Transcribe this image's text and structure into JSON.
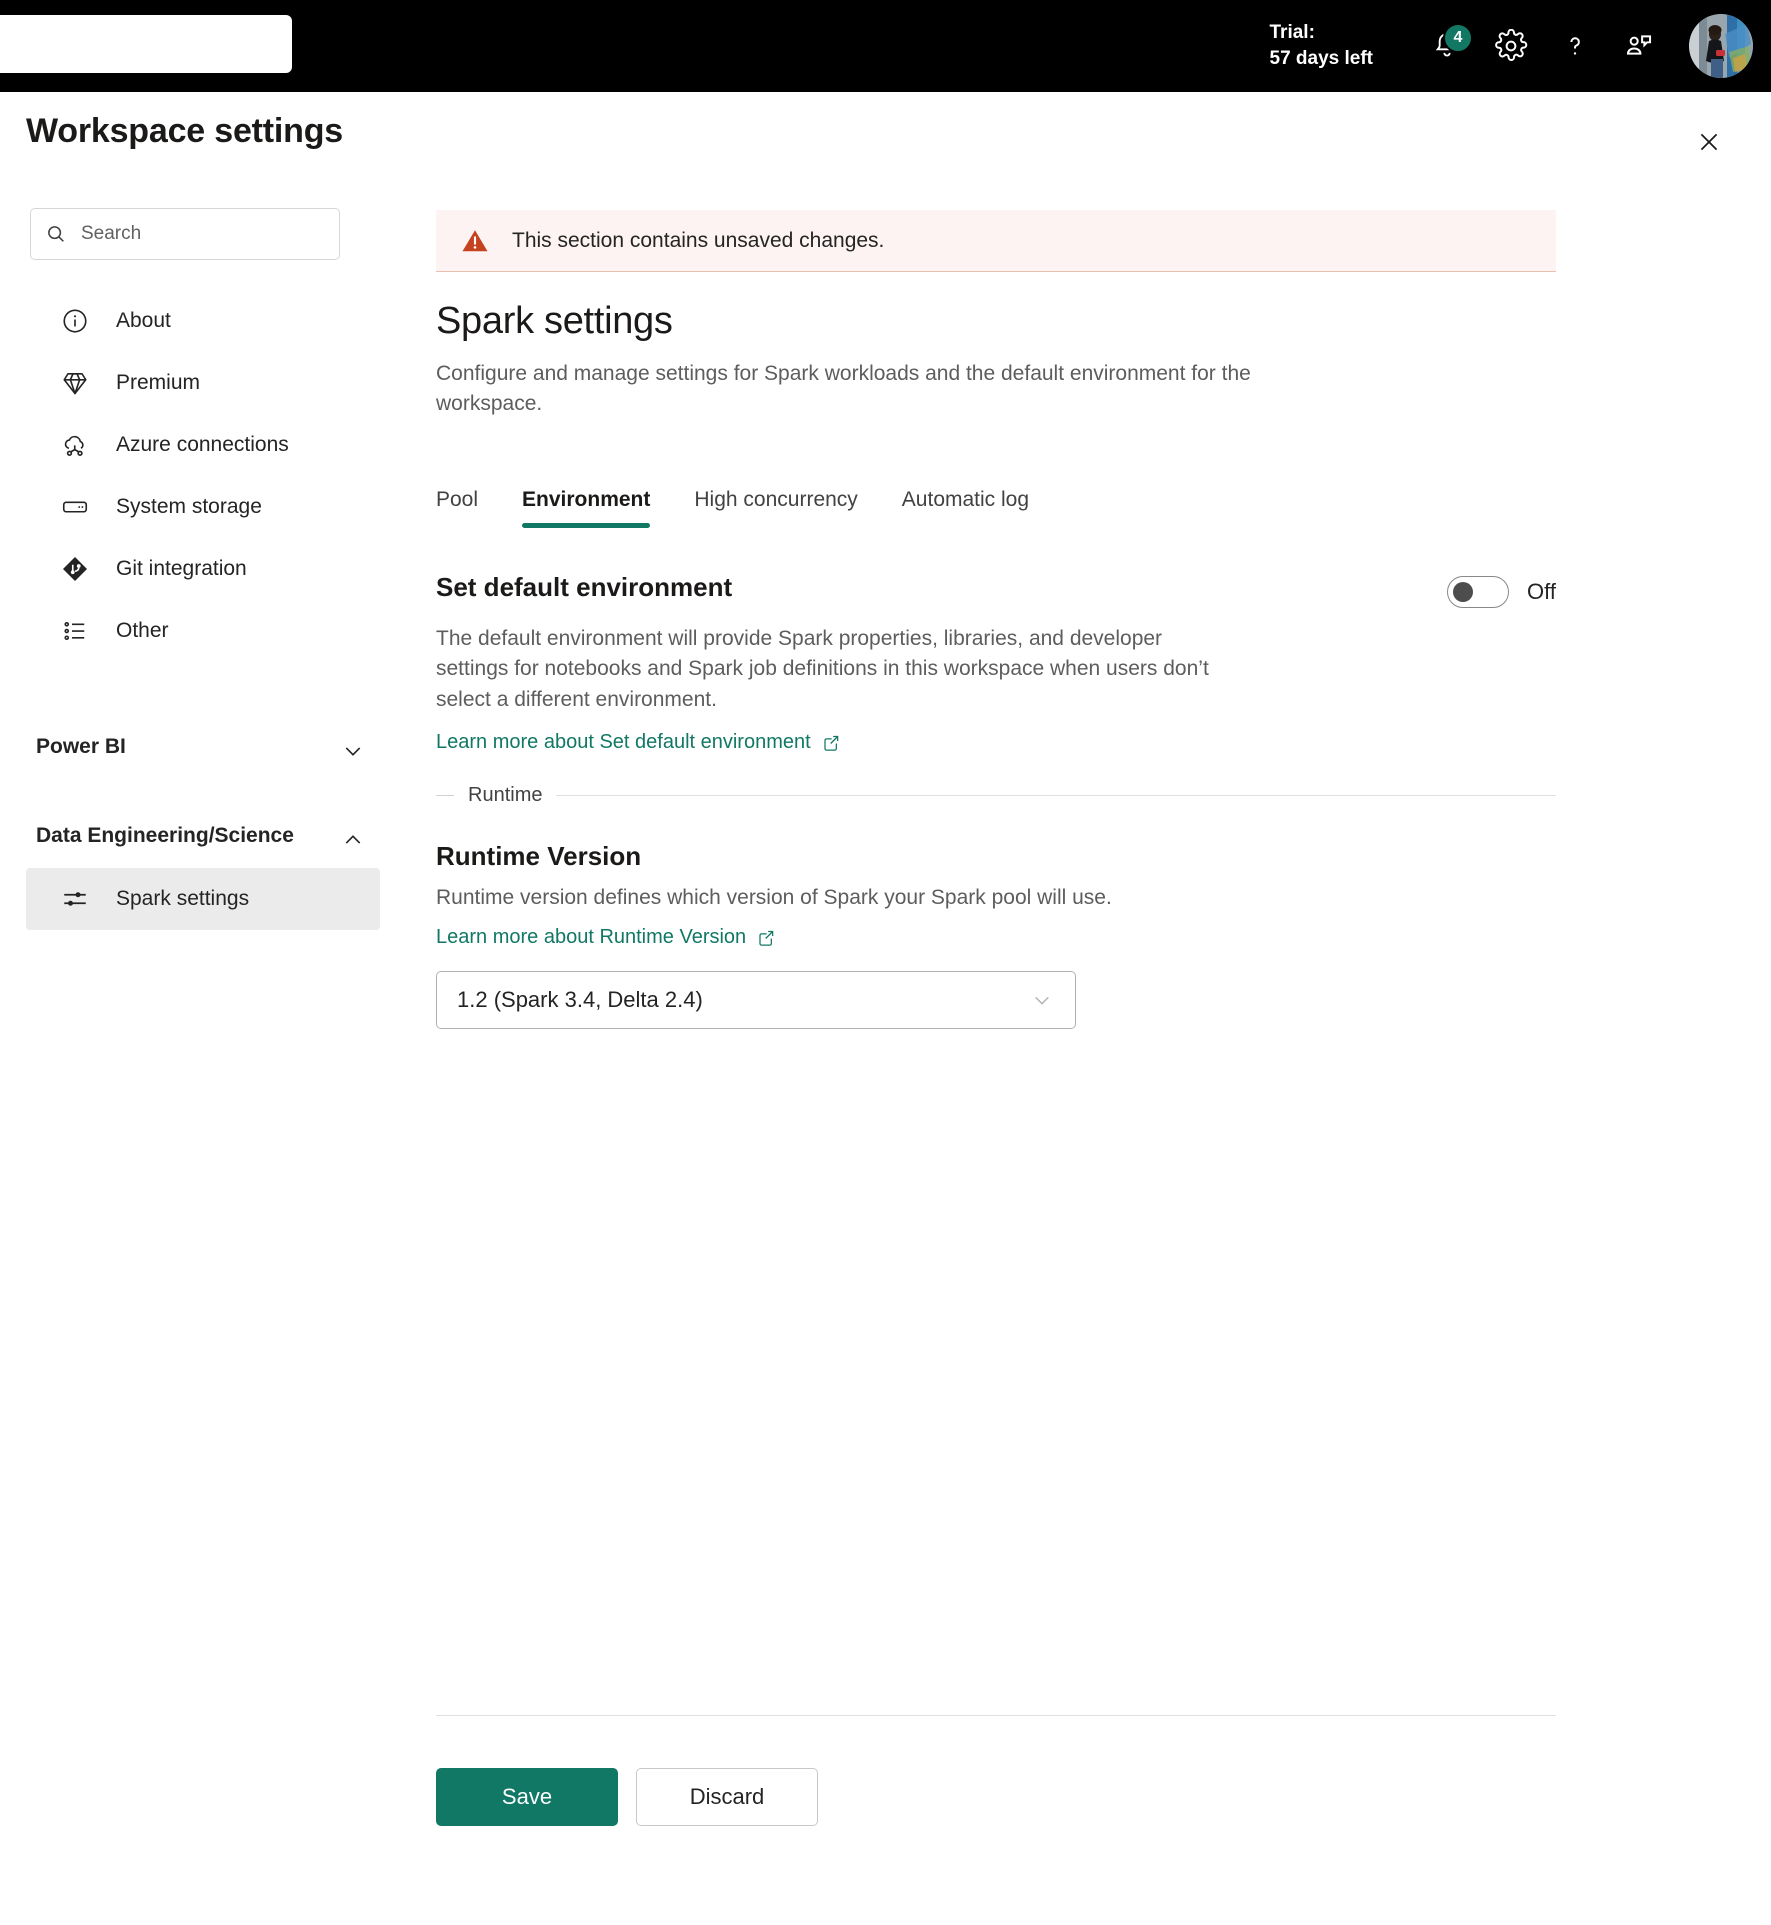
{
  "topbar": {
    "search_value": "",
    "search_placeholder": "",
    "trial_line1": "Trial:",
    "trial_line2": "57 days left",
    "notifications_badge": "4",
    "icons": {
      "bell": "bell-icon",
      "gear": "gear-icon",
      "help": "help-icon",
      "feedback": "feedback-icon",
      "avatar": "user-avatar"
    },
    "accent_color": "#127763"
  },
  "header": {
    "title": "Workspace settings",
    "close_label": "Close"
  },
  "sidebar": {
    "search_placeholder": "Search",
    "search_value": "",
    "items": [
      {
        "label": "About",
        "icon": "info-circle-icon",
        "selected": false
      },
      {
        "label": "Premium",
        "icon": "diamond-icon",
        "selected": false
      },
      {
        "label": "Azure connections",
        "icon": "cloud-link-icon",
        "selected": false
      },
      {
        "label": "System storage",
        "icon": "storage-icon",
        "selected": false
      },
      {
        "label": "Git integration",
        "icon": "git-icon",
        "selected": false
      },
      {
        "label": "Other",
        "icon": "list-icon",
        "selected": false
      }
    ],
    "groups": [
      {
        "title": "Power BI",
        "expanded": false,
        "chevron": "chevron-down-icon",
        "items": []
      },
      {
        "title": "Data Engineering/Science",
        "expanded": true,
        "chevron": "chevron-up-icon",
        "items": [
          {
            "label": "Spark settings",
            "icon": "sliders-icon",
            "selected": true
          }
        ]
      }
    ]
  },
  "main": {
    "banner": {
      "icon": "warning-triangle-icon",
      "text": "This section contains unsaved changes.",
      "background": "#fdf3f2",
      "icon_color": "#c4431e"
    },
    "title": "Spark settings",
    "description": "Configure and manage settings for Spark workloads and the default environment for the workspace.",
    "tabs": [
      {
        "label": "Pool",
        "active": false
      },
      {
        "label": "Environment",
        "active": true
      },
      {
        "label": "High concurrency",
        "active": false
      },
      {
        "label": "Automatic log",
        "active": false
      }
    ],
    "active_tab_underline_color": "#117865",
    "default_environment": {
      "label": "Set default environment",
      "toggle_state": "Off",
      "toggle_on": false,
      "description": "The default environment will provide Spark properties, libraries, and developer settings for notebooks and Spark job definitions in this workspace when users don’t select a different environment.",
      "link_text": "Learn more about Set default environment",
      "link_icon": "open-in-new-icon"
    },
    "runtime_section": {
      "legend": "Runtime",
      "title": "Runtime Version",
      "description": "Runtime version defines which version of Spark your Spark pool will use.",
      "link_text": "Learn more about Runtime Version",
      "link_icon": "open-in-new-icon",
      "dropdown": {
        "value": "1.2 (Spark 3.4, Delta 2.4)",
        "chevron": "chevron-down-icon"
      }
    },
    "footer": {
      "save_label": "Save",
      "discard_label": "Discard",
      "primary_color": "#117865"
    }
  }
}
